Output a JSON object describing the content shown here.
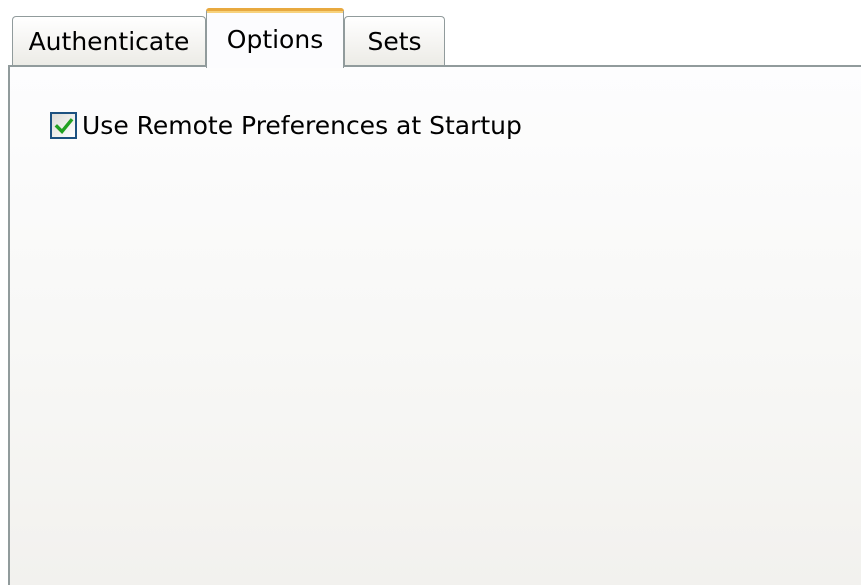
{
  "tabs": [
    {
      "label": "Authenticate",
      "selected": false
    },
    {
      "label": "Options",
      "selected": true
    },
    {
      "label": "Sets",
      "selected": false
    }
  ],
  "options_panel": {
    "use_remote_preferences": {
      "label": "Use Remote Preferences at Startup",
      "checked": true
    }
  },
  "colors": {
    "selected_tab_accent": "#e8a93f",
    "checkmark": "#21a121",
    "checkbox_border": "#1c5180",
    "tab_border": "#919b9c"
  },
  "icons": {
    "checkbox_mark": "checkmark-icon"
  }
}
